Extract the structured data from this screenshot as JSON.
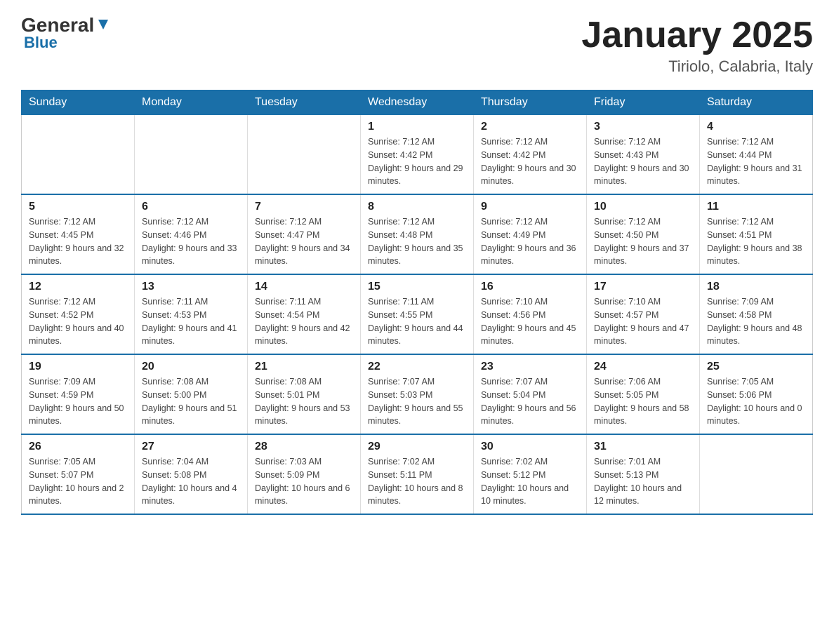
{
  "header": {
    "logo_general": "General",
    "logo_blue": "Blue",
    "month": "January 2025",
    "location": "Tiriolo, Calabria, Italy"
  },
  "days_of_week": [
    "Sunday",
    "Monday",
    "Tuesday",
    "Wednesday",
    "Thursday",
    "Friday",
    "Saturday"
  ],
  "weeks": [
    {
      "days": [
        {
          "number": "",
          "info": ""
        },
        {
          "number": "",
          "info": ""
        },
        {
          "number": "",
          "info": ""
        },
        {
          "number": "1",
          "info": "Sunrise: 7:12 AM\nSunset: 4:42 PM\nDaylight: 9 hours and 29 minutes."
        },
        {
          "number": "2",
          "info": "Sunrise: 7:12 AM\nSunset: 4:42 PM\nDaylight: 9 hours and 30 minutes."
        },
        {
          "number": "3",
          "info": "Sunrise: 7:12 AM\nSunset: 4:43 PM\nDaylight: 9 hours and 30 minutes."
        },
        {
          "number": "4",
          "info": "Sunrise: 7:12 AM\nSunset: 4:44 PM\nDaylight: 9 hours and 31 minutes."
        }
      ]
    },
    {
      "days": [
        {
          "number": "5",
          "info": "Sunrise: 7:12 AM\nSunset: 4:45 PM\nDaylight: 9 hours and 32 minutes."
        },
        {
          "number": "6",
          "info": "Sunrise: 7:12 AM\nSunset: 4:46 PM\nDaylight: 9 hours and 33 minutes."
        },
        {
          "number": "7",
          "info": "Sunrise: 7:12 AM\nSunset: 4:47 PM\nDaylight: 9 hours and 34 minutes."
        },
        {
          "number": "8",
          "info": "Sunrise: 7:12 AM\nSunset: 4:48 PM\nDaylight: 9 hours and 35 minutes."
        },
        {
          "number": "9",
          "info": "Sunrise: 7:12 AM\nSunset: 4:49 PM\nDaylight: 9 hours and 36 minutes."
        },
        {
          "number": "10",
          "info": "Sunrise: 7:12 AM\nSunset: 4:50 PM\nDaylight: 9 hours and 37 minutes."
        },
        {
          "number": "11",
          "info": "Sunrise: 7:12 AM\nSunset: 4:51 PM\nDaylight: 9 hours and 38 minutes."
        }
      ]
    },
    {
      "days": [
        {
          "number": "12",
          "info": "Sunrise: 7:12 AM\nSunset: 4:52 PM\nDaylight: 9 hours and 40 minutes."
        },
        {
          "number": "13",
          "info": "Sunrise: 7:11 AM\nSunset: 4:53 PM\nDaylight: 9 hours and 41 minutes."
        },
        {
          "number": "14",
          "info": "Sunrise: 7:11 AM\nSunset: 4:54 PM\nDaylight: 9 hours and 42 minutes."
        },
        {
          "number": "15",
          "info": "Sunrise: 7:11 AM\nSunset: 4:55 PM\nDaylight: 9 hours and 44 minutes."
        },
        {
          "number": "16",
          "info": "Sunrise: 7:10 AM\nSunset: 4:56 PM\nDaylight: 9 hours and 45 minutes."
        },
        {
          "number": "17",
          "info": "Sunrise: 7:10 AM\nSunset: 4:57 PM\nDaylight: 9 hours and 47 minutes."
        },
        {
          "number": "18",
          "info": "Sunrise: 7:09 AM\nSunset: 4:58 PM\nDaylight: 9 hours and 48 minutes."
        }
      ]
    },
    {
      "days": [
        {
          "number": "19",
          "info": "Sunrise: 7:09 AM\nSunset: 4:59 PM\nDaylight: 9 hours and 50 minutes."
        },
        {
          "number": "20",
          "info": "Sunrise: 7:08 AM\nSunset: 5:00 PM\nDaylight: 9 hours and 51 minutes."
        },
        {
          "number": "21",
          "info": "Sunrise: 7:08 AM\nSunset: 5:01 PM\nDaylight: 9 hours and 53 minutes."
        },
        {
          "number": "22",
          "info": "Sunrise: 7:07 AM\nSunset: 5:03 PM\nDaylight: 9 hours and 55 minutes."
        },
        {
          "number": "23",
          "info": "Sunrise: 7:07 AM\nSunset: 5:04 PM\nDaylight: 9 hours and 56 minutes."
        },
        {
          "number": "24",
          "info": "Sunrise: 7:06 AM\nSunset: 5:05 PM\nDaylight: 9 hours and 58 minutes."
        },
        {
          "number": "25",
          "info": "Sunrise: 7:05 AM\nSunset: 5:06 PM\nDaylight: 10 hours and 0 minutes."
        }
      ]
    },
    {
      "days": [
        {
          "number": "26",
          "info": "Sunrise: 7:05 AM\nSunset: 5:07 PM\nDaylight: 10 hours and 2 minutes."
        },
        {
          "number": "27",
          "info": "Sunrise: 7:04 AM\nSunset: 5:08 PM\nDaylight: 10 hours and 4 minutes."
        },
        {
          "number": "28",
          "info": "Sunrise: 7:03 AM\nSunset: 5:09 PM\nDaylight: 10 hours and 6 minutes."
        },
        {
          "number": "29",
          "info": "Sunrise: 7:02 AM\nSunset: 5:11 PM\nDaylight: 10 hours and 8 minutes."
        },
        {
          "number": "30",
          "info": "Sunrise: 7:02 AM\nSunset: 5:12 PM\nDaylight: 10 hours and 10 minutes."
        },
        {
          "number": "31",
          "info": "Sunrise: 7:01 AM\nSunset: 5:13 PM\nDaylight: 10 hours and 12 minutes."
        },
        {
          "number": "",
          "info": ""
        }
      ]
    }
  ]
}
